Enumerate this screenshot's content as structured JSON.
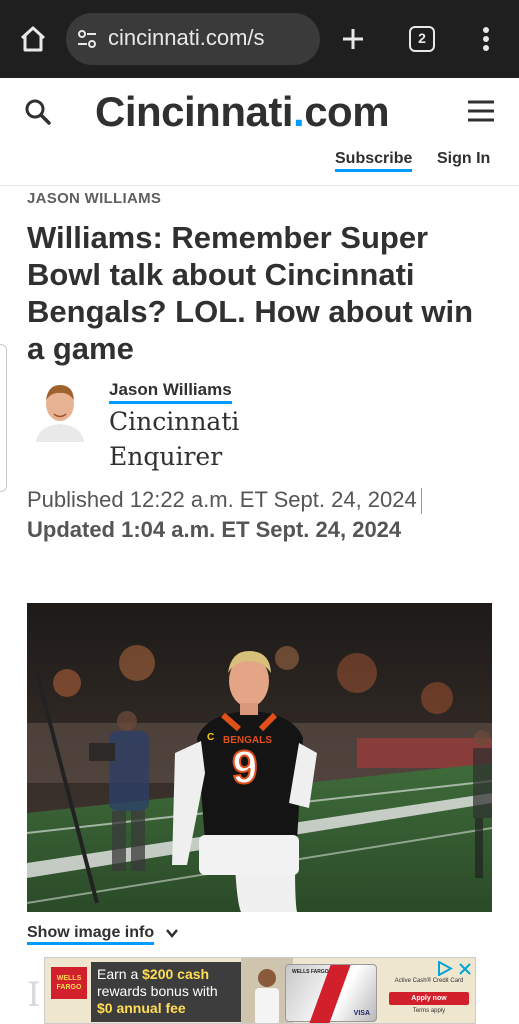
{
  "browser": {
    "url": "cincinnati.com/s",
    "tab_count": "2"
  },
  "site": {
    "logo_text": "Cincinnati.com",
    "subscribe_label": "Subscribe",
    "signin_label": "Sign In"
  },
  "article": {
    "author_label": "JASON WILLIAMS",
    "headline": "Williams: Remember Super Bowl talk about Cincinnati Bengals? LOL. How about win a game",
    "author_name": "Jason Williams",
    "publication": "Cincinnati Enquirer",
    "published": "Published 12:22 a.m. ET Sept. 24, 2024",
    "updated": "Updated 1:04 a.m. ET Sept. 24, 2024",
    "image_info_label": "Show image info",
    "photo": {
      "jersey_name": "BENGALS",
      "jersey_number": "9",
      "jersey_badge": "C"
    },
    "body_first_char": "I"
  },
  "ad": {
    "brand": "WELLS FARGO",
    "pitch_pre": "Earn a ",
    "pitch_amount": "$200 cash",
    "pitch_mid": " rewards bonus with ",
    "pitch_fee": "$0 annual fee",
    "card_bank": "WELLS FARGO",
    "card_network": "VISA",
    "offer_name": "Active Cash® Credit Card",
    "apply_label": "Apply now",
    "terms_label": "Terms apply"
  },
  "colors": {
    "accent": "#009bff",
    "chrome_bg": "#1f1f1f",
    "text_dark": "#303030"
  }
}
